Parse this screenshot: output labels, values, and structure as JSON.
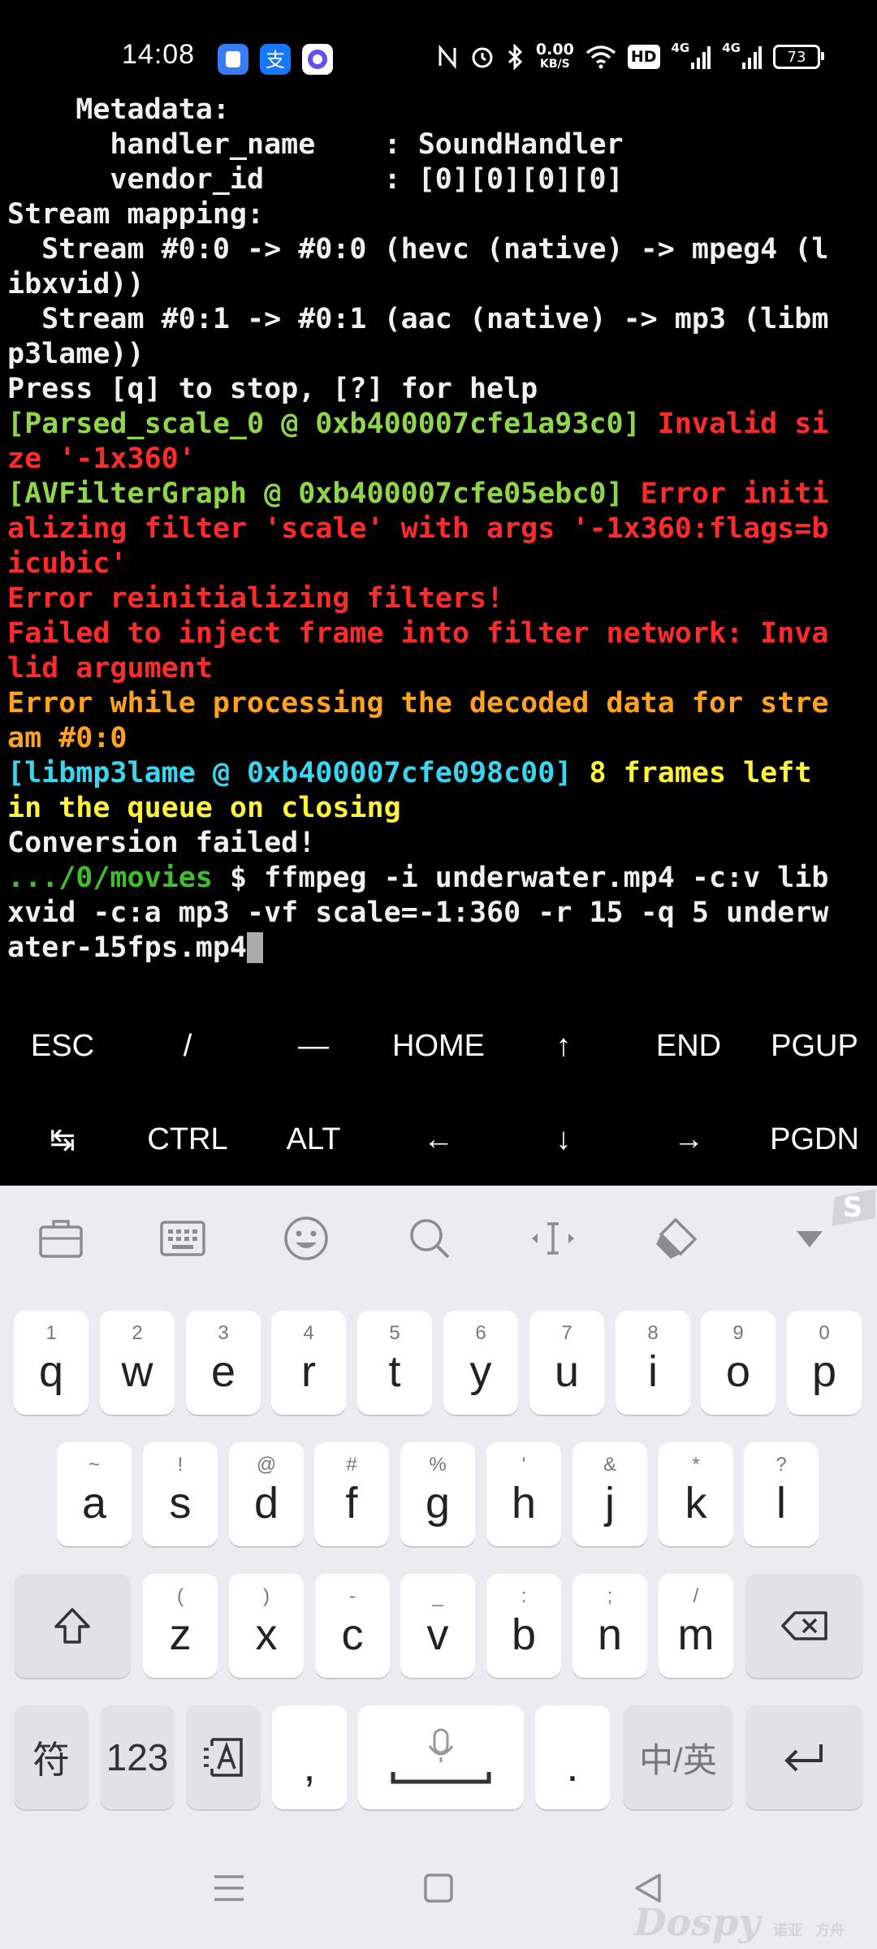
{
  "status_bar": {
    "time": "14:08",
    "net_speed_value": "0.00",
    "net_speed_unit": "KB/S",
    "signal_1_label": "4G",
    "signal_2_label": "4G",
    "hd_label": "HD",
    "battery": "73"
  },
  "terminal": {
    "lines": [
      [
        {
          "t": "    Metadata:",
          "c": "white"
        }
      ],
      [
        {
          "t": "      handler_name    : SoundHandler",
          "c": "white"
        }
      ],
      [
        {
          "t": "      vendor_id       : [0][0][0][0]",
          "c": "white"
        }
      ],
      [
        {
          "t": "Stream mapping:",
          "c": "white"
        }
      ],
      [
        {
          "t": "  Stream #0:0 -> #0:0 (hevc (native) -> mpeg4 (l",
          "c": "white"
        }
      ],
      [
        {
          "t": "ibxvid))",
          "c": "white"
        }
      ],
      [
        {
          "t": "  Stream #0:1 -> #0:1 (aac (native) -> mp3 (libm",
          "c": "white"
        }
      ],
      [
        {
          "t": "p3lame))",
          "c": "white"
        }
      ],
      [
        {
          "t": "Press [q] to stop, [?] for help",
          "c": "white"
        }
      ],
      [
        {
          "t": "[Parsed_scale_0 @ 0xb400007cfe1a93c0] ",
          "c": "green"
        },
        {
          "t": "Invalid si",
          "c": "red"
        }
      ],
      [
        {
          "t": "ze '-1x360'",
          "c": "red"
        }
      ],
      [
        {
          "t": "[AVFilterGraph @ 0xb400007cfe05ebc0] ",
          "c": "green"
        },
        {
          "t": "Error initi",
          "c": "red"
        }
      ],
      [
        {
          "t": "alizing filter 'scale' with args '-1x360:flags=b",
          "c": "red"
        }
      ],
      [
        {
          "t": "icubic'",
          "c": "red"
        }
      ],
      [
        {
          "t": "Error reinitializing filters!",
          "c": "red"
        }
      ],
      [
        {
          "t": "Failed to inject frame into filter network: Inva",
          "c": "red"
        }
      ],
      [
        {
          "t": "lid argument",
          "c": "red"
        }
      ],
      [
        {
          "t": "Error while processing the decoded data for stre",
          "c": "orange"
        }
      ],
      [
        {
          "t": "am #0:0",
          "c": "orange"
        }
      ],
      [
        {
          "t": "[libmp3lame @ 0xb400007cfe098c00] ",
          "c": "cyan"
        },
        {
          "t": "8 frames left",
          "c": "yellow"
        }
      ],
      [
        {
          "t": "in the queue on closing",
          "c": "yellow"
        }
      ],
      [
        {
          "t": "Conversion failed!",
          "c": "white"
        }
      ],
      [
        {
          "t": ".../0/movies",
          "c": "dkgreen"
        },
        {
          "t": " $ ffmpeg -i underwater.mp4 -c:v lib",
          "c": "white"
        }
      ],
      [
        {
          "t": "xvid -c:a mp3 -vf scale=-1:360 -r 15 -q 5 underw",
          "c": "white"
        }
      ],
      [
        {
          "t": "ater-15fps.mp4",
          "c": "white"
        }
      ]
    ]
  },
  "extra_keys": {
    "row1": [
      "ESC",
      "/",
      "—",
      "HOME",
      "↑",
      "END",
      "PGUP"
    ],
    "row2": [
      "↹",
      "CTRL",
      "ALT",
      "←",
      "↓",
      "→",
      "PGDN"
    ]
  },
  "keyboard": {
    "row1": [
      {
        "hint": "1",
        "key": "q"
      },
      {
        "hint": "2",
        "key": "w"
      },
      {
        "hint": "3",
        "key": "e"
      },
      {
        "hint": "4",
        "key": "r"
      },
      {
        "hint": "5",
        "key": "t"
      },
      {
        "hint": "6",
        "key": "y"
      },
      {
        "hint": "7",
        "key": "u"
      },
      {
        "hint": "8",
        "key": "i"
      },
      {
        "hint": "9",
        "key": "o"
      },
      {
        "hint": "0",
        "key": "p"
      }
    ],
    "row2": [
      {
        "hint": "~",
        "key": "a"
      },
      {
        "hint": "!",
        "key": "s"
      },
      {
        "hint": "@",
        "key": "d"
      },
      {
        "hint": "#",
        "key": "f"
      },
      {
        "hint": "%",
        "key": "g"
      },
      {
        "hint": "'",
        "key": "h"
      },
      {
        "hint": "&",
        "key": "j"
      },
      {
        "hint": "*",
        "key": "k"
      },
      {
        "hint": "?",
        "key": "l"
      }
    ],
    "row3": [
      {
        "hint": "(",
        "key": "z"
      },
      {
        "hint": ")",
        "key": "x"
      },
      {
        "hint": "-",
        "key": "c"
      },
      {
        "hint": "_",
        "key": "v"
      },
      {
        "hint": ":",
        "key": "b"
      },
      {
        "hint": ";",
        "key": "n"
      },
      {
        "hint": "/",
        "key": "m"
      }
    ],
    "symbols_label": "符",
    "numbers_label": "123",
    "comma_label": ",",
    "period_label": ".",
    "lang_label": "中/英"
  },
  "watermark": {
    "brand": "Dospy",
    "sub1": "诺亚",
    "sub2": "方舟"
  }
}
